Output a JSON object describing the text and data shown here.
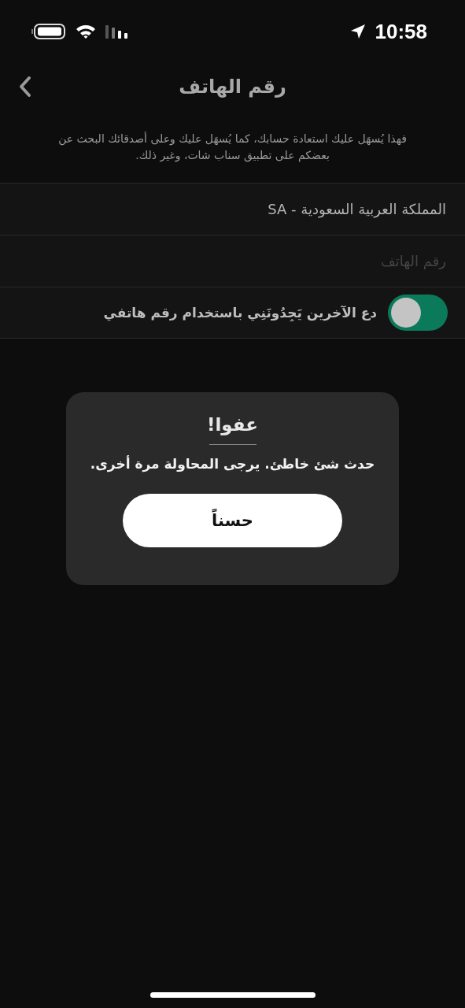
{
  "status_bar": {
    "time": "10:58"
  },
  "nav": {
    "title": "رقم الهاتف"
  },
  "description": "فهذا يُسهَل عليك استعادة حسابك، كما يُسهَل عليك وعلى أصدقائك البحث عن بعضكم على تطبيق سناب شات، وغير ذلك.",
  "form": {
    "country": "المملكة العربية السعودية - SA",
    "phone": {
      "placeholder": "رقم الهاتف"
    },
    "discoverable": {
      "label": "دع الآخرين يَجِدُونَنِي باستخدام رقم هاتفي",
      "on": true
    }
  },
  "dialog": {
    "title": "عفوا!",
    "message": "حدث شئ خاطئ. يرجى المحاولة مرة أخرى.",
    "button": "حسناً"
  }
}
